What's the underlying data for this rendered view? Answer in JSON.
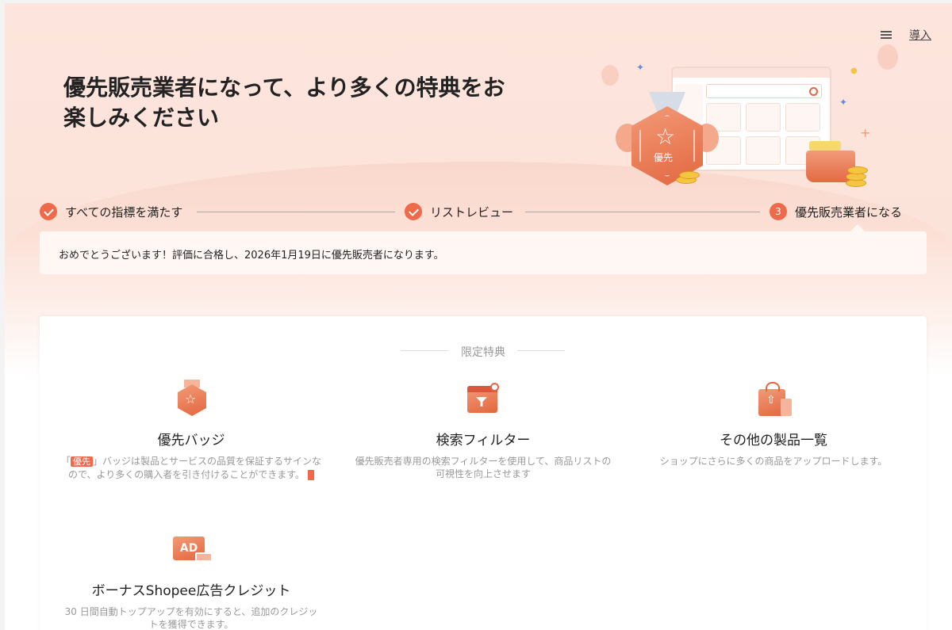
{
  "header": {
    "guide_label": "導入",
    "title": "優先販売業者になって、より多くの特典をお楽しみください",
    "illustration_badge_text": "優先"
  },
  "stepper": {
    "steps": [
      {
        "label": "すべての指標を満たす",
        "state": "done"
      },
      {
        "label": "リストレビュー",
        "state": "done"
      },
      {
        "label": "優先販売業者になる",
        "state": "current",
        "number": "3"
      }
    ]
  },
  "notice": {
    "text": "おめでとうございます！評価に合格し、2026年1月19日に優先販売者になります。"
  },
  "benefits": {
    "section_title": "限定特典",
    "items": [
      {
        "title": "優先バッジ",
        "desc_prefix": "「",
        "desc_tag": "優先",
        "desc_rest": "」バッジは製品とサービスの品質を保証するサインなので、より多くの購入者を引き付けることができます。",
        "icon": "badge-icon"
      },
      {
        "title": "検索フィルター",
        "desc": "優先販売者専用の検索フィルターを使用して、商品リストの可視性を向上させます",
        "icon": "search-filter-icon"
      },
      {
        "title": "その他の製品一覧",
        "desc": "ショップにさらに多くの商品をアップロードします。",
        "icon": "upload-bag-icon"
      },
      {
        "title": "ボーナスShopee広告クレジット",
        "desc": "30 日間自動トップアップを有効にすると、追加のクレジットを獲得できます。",
        "icon": "ad-icon",
        "icon_text": "AD"
      }
    ]
  },
  "colors": {
    "accent": "#ee6a4a",
    "header_bg": "#fde5dd",
    "notice_bg": "#fff7f4"
  }
}
